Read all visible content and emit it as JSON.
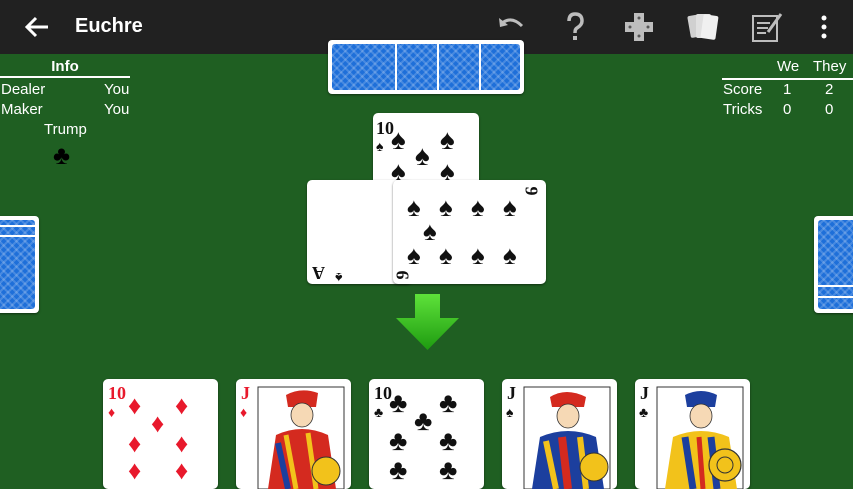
{
  "toolbar": {
    "title": "Euchre",
    "icons": [
      "back-arrow-icon",
      "undo-icon",
      "help-icon",
      "dpad-icon",
      "cards-icon",
      "scorepad-icon",
      "more-vert-icon"
    ]
  },
  "info": {
    "heading": "Info",
    "dealer_label": "Dealer",
    "dealer_value": "You",
    "maker_label": "Maker",
    "maker_value": "You",
    "trump_label": "Trump",
    "trump_suit": "♣"
  },
  "score": {
    "col_we": "We",
    "col_they": "They",
    "score_label": "Score",
    "score_we": "1",
    "score_they": "2",
    "tricks_label": "Tricks",
    "tricks_we": "0",
    "tricks_they": "0"
  },
  "trick": {
    "left_card": {
      "rank": "A",
      "suit": "♠"
    },
    "top_card": {
      "rank": "10",
      "suit": "♠"
    },
    "right_card": {
      "rank": "9",
      "suit": "♠"
    }
  },
  "hand": [
    {
      "rank": "10",
      "suit": "♦"
    },
    {
      "rank": "J",
      "suit": "♦"
    },
    {
      "rank": "10",
      "suit": "♣"
    },
    {
      "rank": "J",
      "suit": "♠"
    },
    {
      "rank": "J",
      "suit": "♣"
    }
  ],
  "colors": {
    "felt": "#1f5f22",
    "toolbar": "#212121",
    "card_back": "#1e6fd9",
    "arrow": "#3bbf1c",
    "red_suit": "#e8192c"
  }
}
